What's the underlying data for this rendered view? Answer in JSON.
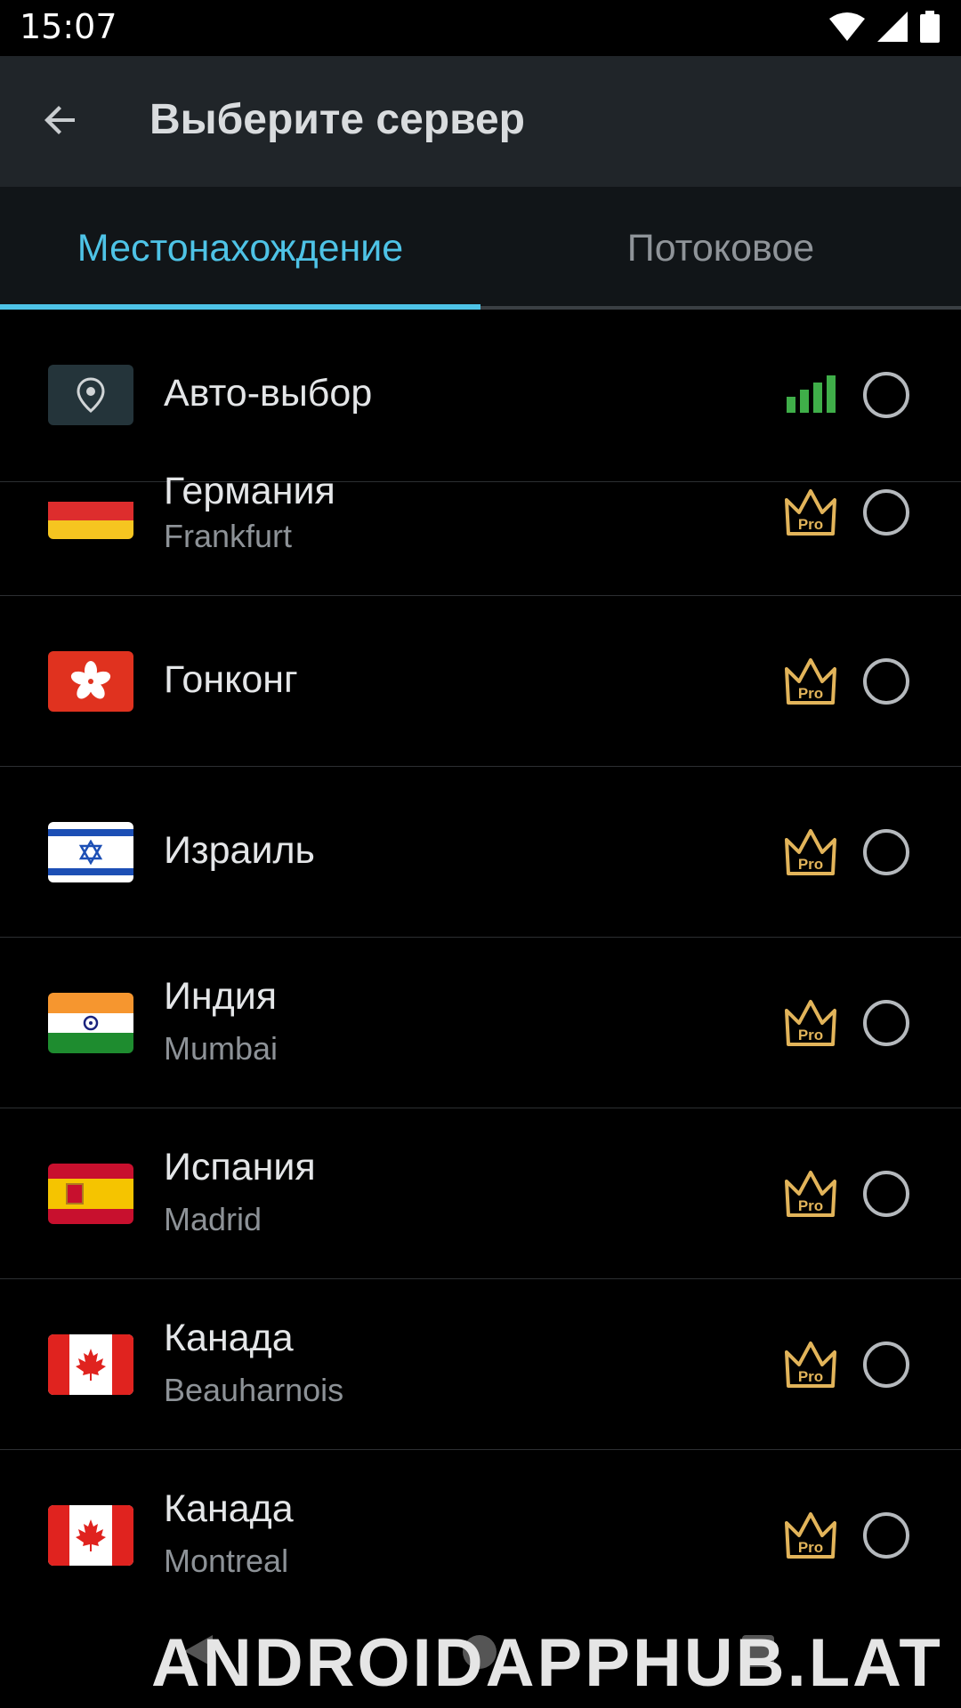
{
  "status_bar": {
    "time": "15:07"
  },
  "app_bar": {
    "title": "Выберите сервер"
  },
  "tabs": [
    {
      "label": "Местонахождение",
      "active": true
    },
    {
      "label": "Потоковое",
      "active": false
    }
  ],
  "auto_row": {
    "title": "Авто-выбор"
  },
  "servers": [
    {
      "country": "Германия",
      "city": "Frankfurt",
      "flag": "de",
      "badge": "Pro"
    },
    {
      "country": "Гонконг",
      "city": "",
      "flag": "hk",
      "badge": "Pro"
    },
    {
      "country": "Израиль",
      "city": "",
      "flag": "il",
      "badge": "Pro"
    },
    {
      "country": "Индия",
      "city": "Mumbai",
      "flag": "in",
      "badge": "Pro"
    },
    {
      "country": "Испания",
      "city": "Madrid",
      "flag": "es",
      "badge": "Pro"
    },
    {
      "country": "Канада",
      "city": "Beauharnois",
      "flag": "ca",
      "badge": "Pro"
    },
    {
      "country": "Канада",
      "city": "Montreal",
      "flag": "ca",
      "badge": "Pro"
    }
  ],
  "colors": {
    "accent": "#4ec3e6",
    "pro_gold": "#e2b45a",
    "signal_green": "#3fae49"
  },
  "watermark": {
    "text": "ANDROIDAPPHUB.LAT"
  }
}
